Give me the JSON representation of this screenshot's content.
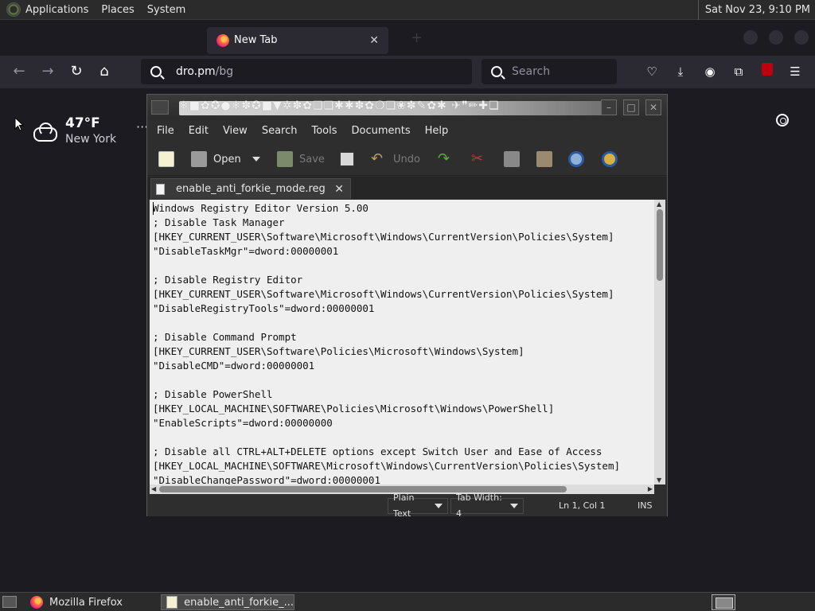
{
  "panel": {
    "menus": [
      "Applications",
      "Places",
      "System"
    ],
    "clock": "Sat Nov 23,  9:10 PM"
  },
  "browser": {
    "tabs": [
      {
        "label": "",
        "active": false
      },
      {
        "label": "New Tab",
        "active": true
      }
    ],
    "url_host": "dro.pm",
    "url_path": "/bg",
    "search_placeholder": "Search"
  },
  "newtab": {
    "temperature": "47°F",
    "city": "New York",
    "menu_dots": "···"
  },
  "gedit": {
    "title_glyphs": "❄■✿✪●❄✽✪■▼✲✽✿❑❏✱✱✽✿❍❏❀✽✎✿✱ ✈❞✏✚❏",
    "menus": [
      "File",
      "Edit",
      "View",
      "Search",
      "Tools",
      "Documents",
      "Help"
    ],
    "toolbar": {
      "open": "Open",
      "save": "Save",
      "undo": "Undo"
    },
    "tab_label": "enable_anti_forkie_mode.reg",
    "lines": [
      "Windows Registry Editor Version 5.00",
      "; Disable Task Manager",
      "[HKEY_CURRENT_USER\\Software\\Microsoft\\Windows\\CurrentVersion\\Policies\\System]",
      "\"DisableTaskMgr\"=dword:00000001",
      "",
      "; Disable Registry Editor",
      "[HKEY_CURRENT_USER\\Software\\Microsoft\\Windows\\CurrentVersion\\Policies\\System]",
      "\"DisableRegistryTools\"=dword:00000001",
      "",
      "; Disable Command Prompt",
      "[HKEY_CURRENT_USER\\Software\\Policies\\Microsoft\\Windows\\System]",
      "\"DisableCMD\"=dword:00000001",
      "",
      "; Disable PowerShell",
      "[HKEY_LOCAL_MACHINE\\SOFTWARE\\Policies\\Microsoft\\Windows\\PowerShell]",
      "\"EnableScripts\"=dword:00000000",
      "",
      "; Disable all CTRL+ALT+DELETE options except Switch User and Ease of Access",
      "[HKEY_LOCAL_MACHINE\\SOFTWARE\\Microsoft\\Windows\\CurrentVersion\\Policies\\System]",
      "\"DisableChangePassword\"=dword:00000001"
    ],
    "status": {
      "language": "Plain Text",
      "tab_width": "Tab Width:  4",
      "position": "Ln 1, Col 1",
      "mode": "INS"
    }
  },
  "taskbar": {
    "items": [
      "Mozilla Firefox",
      "enable_anti_forkie_..."
    ]
  },
  "colors": {
    "firefox_bg": "#1c1b22",
    "toolbar_bg": "#2b2a33",
    "editor_bg": "#efefef"
  }
}
